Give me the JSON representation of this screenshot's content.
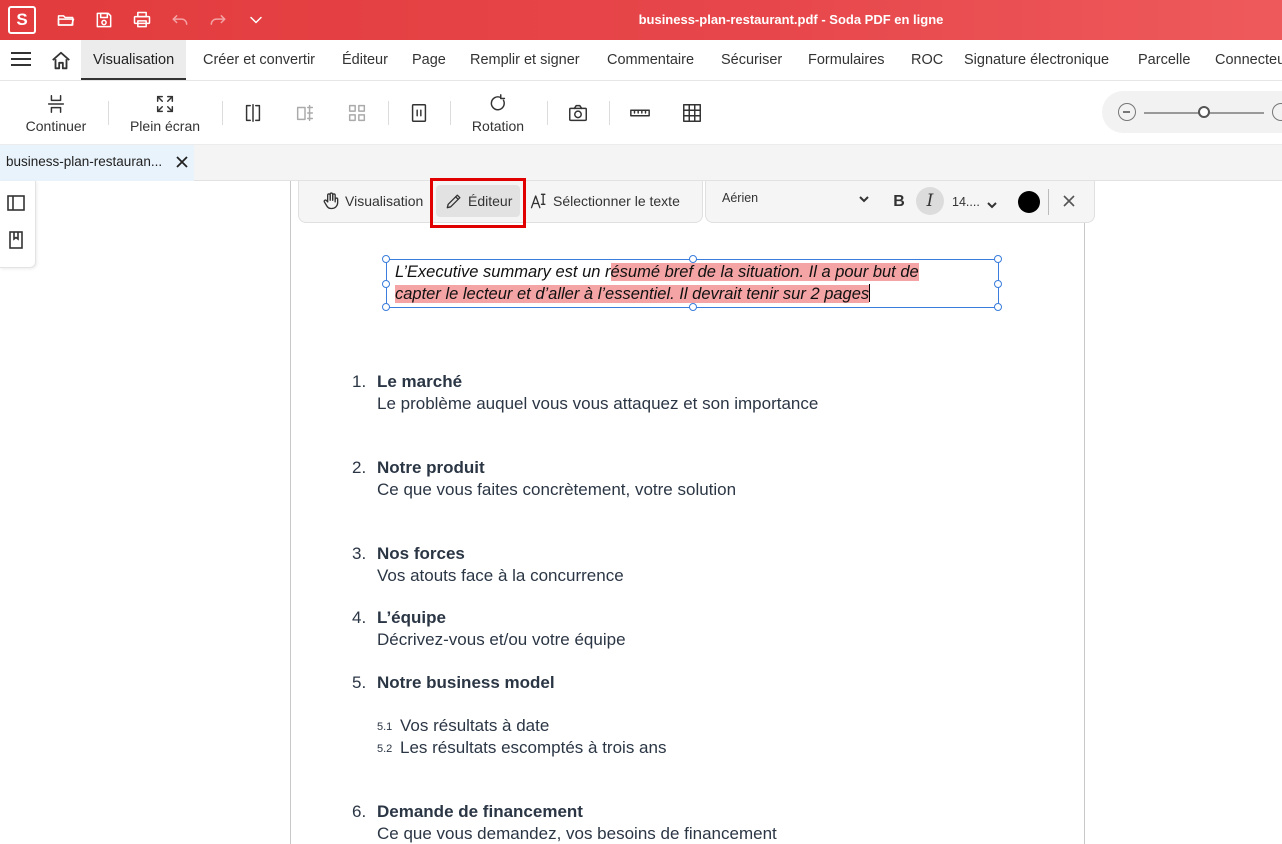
{
  "app": {
    "logo_letter": "S",
    "window_title": "business-plan-restaurant.pdf - Soda PDF en ligne"
  },
  "quick_access": [
    "open-folder-icon",
    "save-icon",
    "print-icon",
    "undo-icon",
    "redo-icon",
    "chevron-down-icon"
  ],
  "menu": {
    "items": [
      "Visualisation",
      "Créer et convertir",
      "Éditeur",
      "Page",
      "Remplir et signer",
      "Commentaire",
      "Sécuriser",
      "Formulaires",
      "ROC",
      "Signature électronique",
      "Parcelle",
      "Connecteurs"
    ],
    "active": "Visualisation"
  },
  "toolbar": {
    "continue_label": "Continuer",
    "fullscreen_label": "Plein écran",
    "rotation_label": "Rotation"
  },
  "doc_tab": {
    "name": "business-plan-restauran..."
  },
  "edit_toolbar": {
    "view_label": "Visualisation",
    "editor_label": "Éditeur",
    "select_text_label": "Sélectionner le texte",
    "font_name": "Aérien",
    "bold_label": "B",
    "italic_label": "I",
    "font_size": "14....",
    "text_color": "#000000"
  },
  "text_box": {
    "line1_plain": "L’Executive summary est un r",
    "line1_selected": "ésumé bref de la situation. Il a pour but de",
    "line2_selected": " capter le lecteur et d’aller à l’essentiel. Il devrait tenir sur 2 pages"
  },
  "list": [
    {
      "num": "1.",
      "title": "Le marché",
      "desc": "Le problème auquel vous vous attaquez et son importance"
    },
    {
      "num": "2.",
      "title": "Notre produit",
      "desc": "Ce que vous faites concrètement, votre solution"
    },
    {
      "num": "3.",
      "title": "Nos forces",
      "desc": "Vos atouts face à la concurrence"
    },
    {
      "num": "4.",
      "title": "L’équipe",
      "desc": "Décrivez-vous et/ou votre équipe"
    },
    {
      "num": "5.",
      "title": "Notre business model",
      "desc": ""
    },
    {
      "num": "6.",
      "title": "Demande de financement",
      "desc": "Ce que vous demandez, vos besoins de financement"
    }
  ],
  "sublist": [
    {
      "num": "5.1",
      "text": "Vos résultats à date"
    },
    {
      "num": "5.2",
      "text": "Les résultats escomptés à trois ans"
    }
  ],
  "colors": {
    "brand": "#e23b3d",
    "selection": "#f4a4a4",
    "highlight_border": "#e00000",
    "text_box_border": "#3a7ddc"
  }
}
